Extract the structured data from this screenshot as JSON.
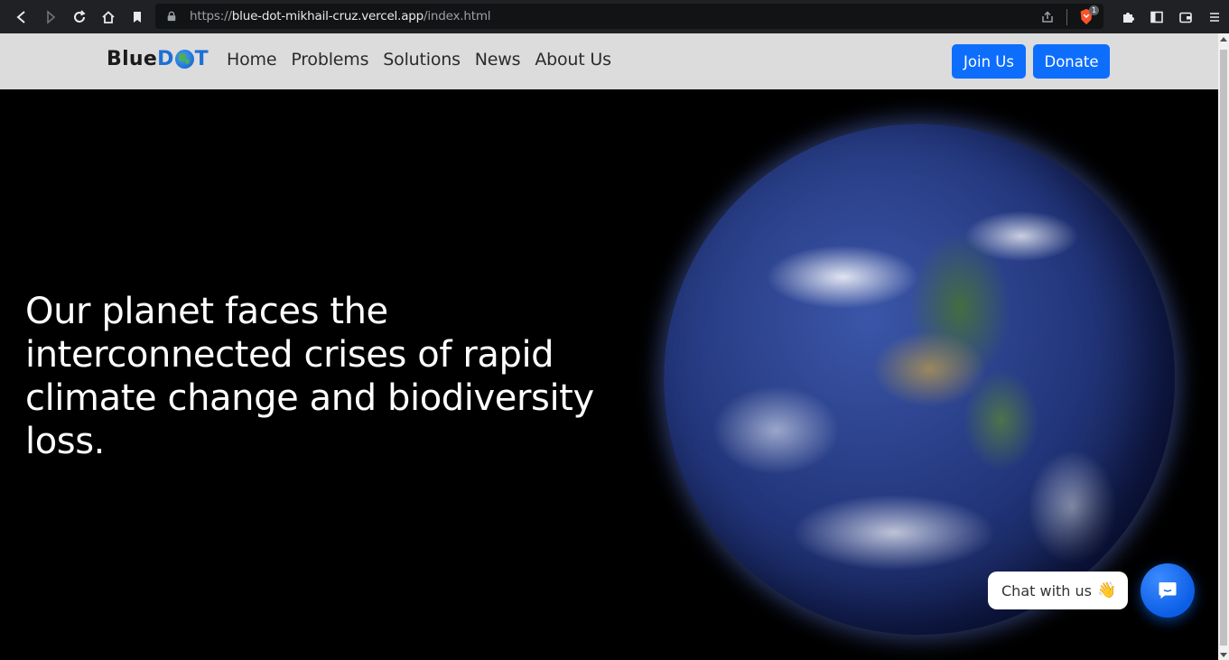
{
  "browser": {
    "url_scheme": "https://",
    "url_host": "blue-dot-mikhail-cruz.vercel.app",
    "url_path": "/index.html",
    "shield_badge": "1"
  },
  "site": {
    "logo_prefix": "Blue",
    "logo_suffix_d": "D",
    "logo_suffix_t": "T",
    "nav": [
      "Home",
      "Problems",
      "Solutions",
      "News",
      "About Us"
    ],
    "join_label": "Join Us",
    "donate_label": "Donate",
    "brand_color": "#0d6efd"
  },
  "hero": {
    "headline": "Our planet faces the interconnected crises of rapid climate change and biodiversity loss."
  },
  "chat": {
    "label": "Chat with us",
    "emoji": "👋"
  }
}
